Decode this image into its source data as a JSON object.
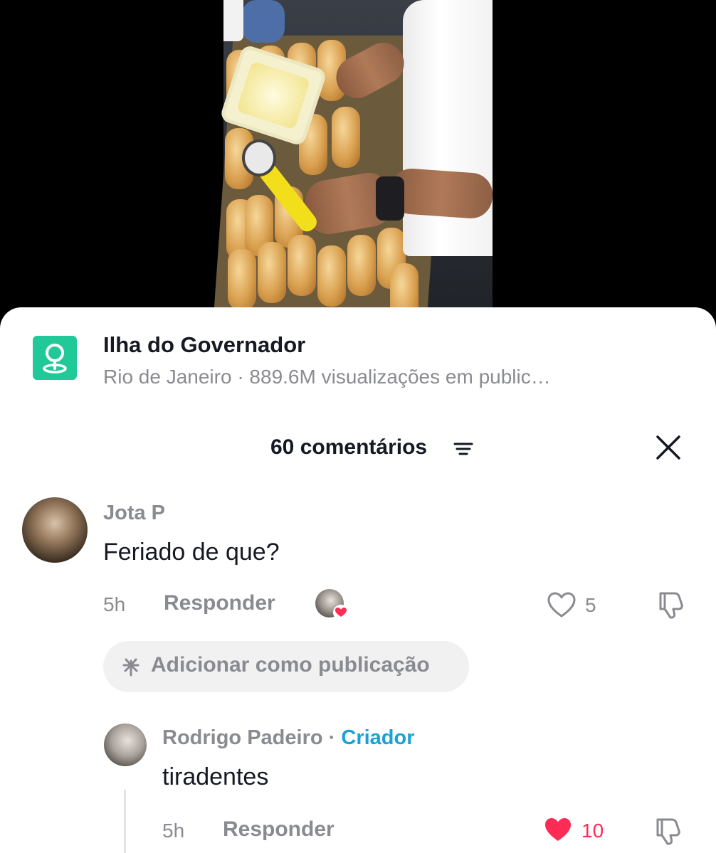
{
  "video": {
    "icons": [
      "video-frame"
    ]
  },
  "location": {
    "icon": "location-pin-icon",
    "title": "Ilha do Governador",
    "subtitle": "Rio de Janeiro · 889.6M visualizações em public…"
  },
  "comments_header": {
    "count_label": "60 comentários",
    "sort_icon": "sort-icon",
    "close_icon": "close-icon"
  },
  "comments": [
    {
      "author": "Jota P",
      "text": "Feriado de que?",
      "time": "5h",
      "reply_label": "Responder",
      "creator_liked": true,
      "likes": "5",
      "liked": false,
      "add_publication_label": "Adicionar como publicação"
    }
  ],
  "replies": [
    {
      "author": "Rodrigo Padeiro",
      "separator": "·",
      "creator_label": "Criador",
      "text": "tiradentes",
      "time": "5h",
      "reply_label": "Responder",
      "likes": "10",
      "liked": true
    }
  ],
  "colors": {
    "accent_like": "#fe2c55",
    "creator": "#1aa2d4",
    "location_icon_bg": "#20c997",
    "muted_text": "#8a8b91"
  }
}
